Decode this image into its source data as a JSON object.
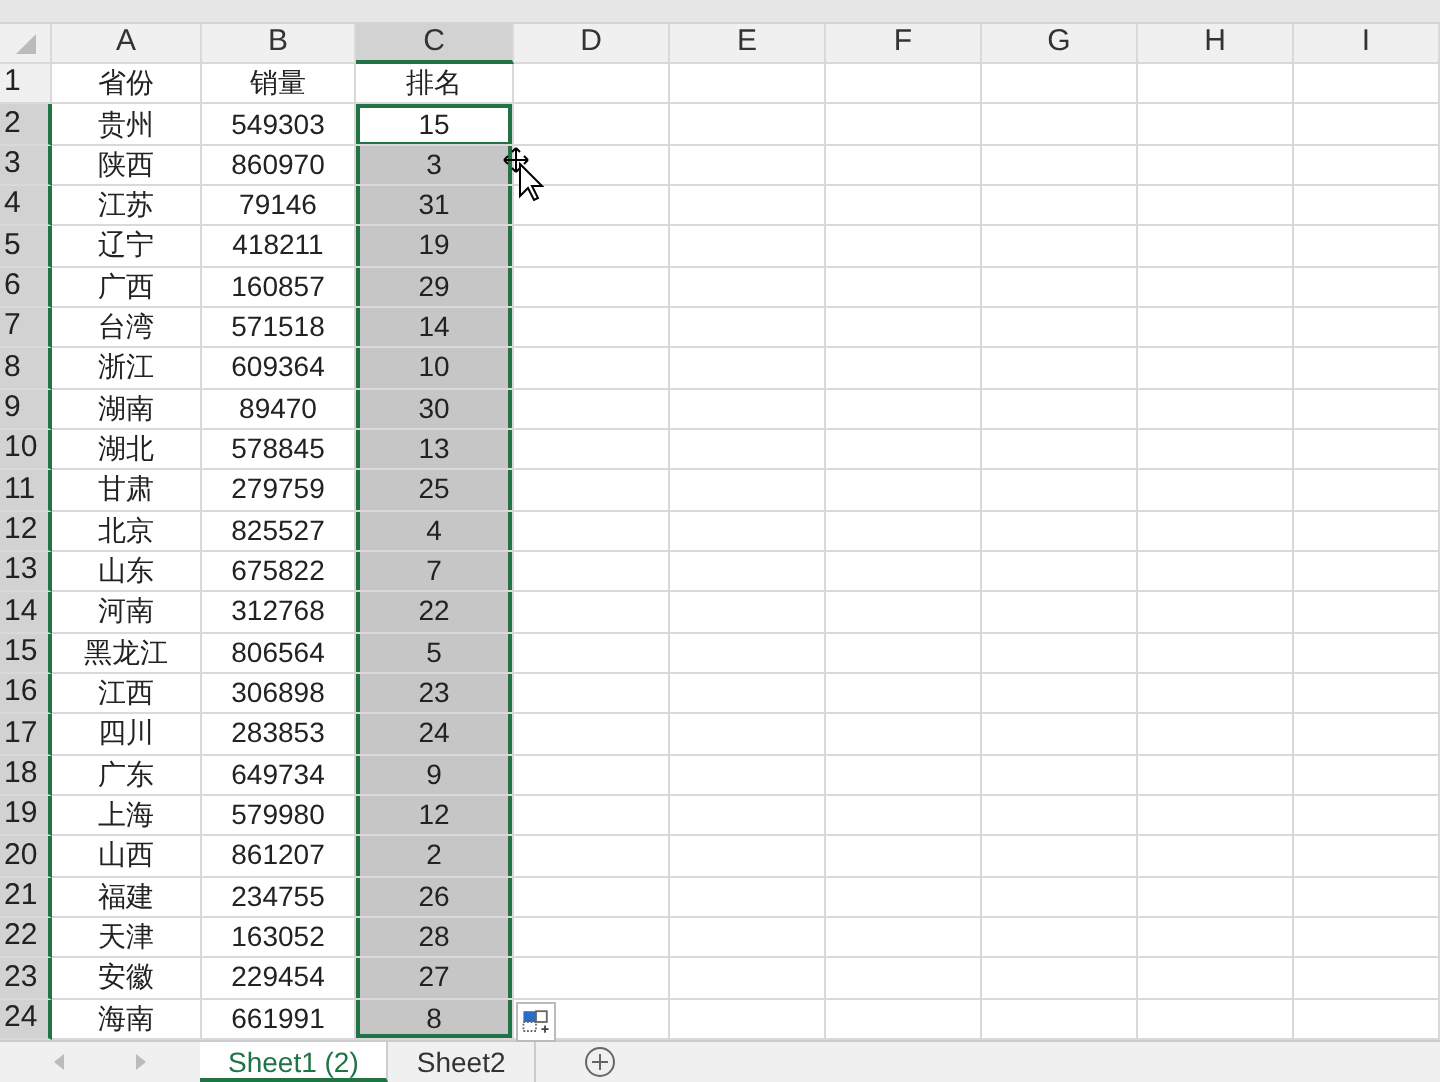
{
  "columns": [
    {
      "label": "A",
      "selected": false
    },
    {
      "label": "B",
      "selected": false
    },
    {
      "label": "C",
      "selected": true
    },
    {
      "label": "D",
      "selected": false
    },
    {
      "label": "E",
      "selected": false
    },
    {
      "label": "F",
      "selected": false
    },
    {
      "label": "G",
      "selected": false
    },
    {
      "label": "H",
      "selected": false
    },
    {
      "label": "I",
      "selected": false
    }
  ],
  "rows": [
    {
      "row": "1",
      "cells": [
        "省份",
        "销量",
        "排名"
      ],
      "selected": false
    },
    {
      "row": "2",
      "cells": [
        "贵州",
        "549303",
        "15"
      ],
      "selected": true
    },
    {
      "row": "3",
      "cells": [
        "陕西",
        "860970",
        "3"
      ],
      "selected": true
    },
    {
      "row": "4",
      "cells": [
        "江苏",
        "79146",
        "31"
      ],
      "selected": true
    },
    {
      "row": "5",
      "cells": [
        "辽宁",
        "418211",
        "19"
      ],
      "selected": true
    },
    {
      "row": "6",
      "cells": [
        "广西",
        "160857",
        "29"
      ],
      "selected": true
    },
    {
      "row": "7",
      "cells": [
        "台湾",
        "571518",
        "14"
      ],
      "selected": true
    },
    {
      "row": "8",
      "cells": [
        "浙江",
        "609364",
        "10"
      ],
      "selected": true
    },
    {
      "row": "9",
      "cells": [
        "湖南",
        "89470",
        "30"
      ],
      "selected": true
    },
    {
      "row": "10",
      "cells": [
        "湖北",
        "578845",
        "13"
      ],
      "selected": true
    },
    {
      "row": "11",
      "cells": [
        "甘肃",
        "279759",
        "25"
      ],
      "selected": true
    },
    {
      "row": "12",
      "cells": [
        "北京",
        "825527",
        "4"
      ],
      "selected": true
    },
    {
      "row": "13",
      "cells": [
        "山东",
        "675822",
        "7"
      ],
      "selected": true
    },
    {
      "row": "14",
      "cells": [
        "河南",
        "312768",
        "22"
      ],
      "selected": true
    },
    {
      "row": "15",
      "cells": [
        "黑龙江",
        "806564",
        "5"
      ],
      "selected": true
    },
    {
      "row": "16",
      "cells": [
        "江西",
        "306898",
        "23"
      ],
      "selected": true
    },
    {
      "row": "17",
      "cells": [
        "四川",
        "283853",
        "24"
      ],
      "selected": true
    },
    {
      "row": "18",
      "cells": [
        "广东",
        "649734",
        "9"
      ],
      "selected": true
    },
    {
      "row": "19",
      "cells": [
        "上海",
        "579980",
        "12"
      ],
      "selected": true
    },
    {
      "row": "20",
      "cells": [
        "山西",
        "861207",
        "2"
      ],
      "selected": true
    },
    {
      "row": "21",
      "cells": [
        "福建",
        "234755",
        "26"
      ],
      "selected": true
    },
    {
      "row": "22",
      "cells": [
        "天津",
        "163052",
        "28"
      ],
      "selected": true
    },
    {
      "row": "23",
      "cells": [
        "安徽",
        "229454",
        "27"
      ],
      "selected": true
    },
    {
      "row": "24",
      "cells": [
        "海南",
        "661991",
        "8"
      ],
      "selected": true
    }
  ],
  "sheet_tabs": [
    {
      "label": "Sheet1 (2)",
      "selected": true
    },
    {
      "label": "Sheet2",
      "selected": false
    }
  ]
}
